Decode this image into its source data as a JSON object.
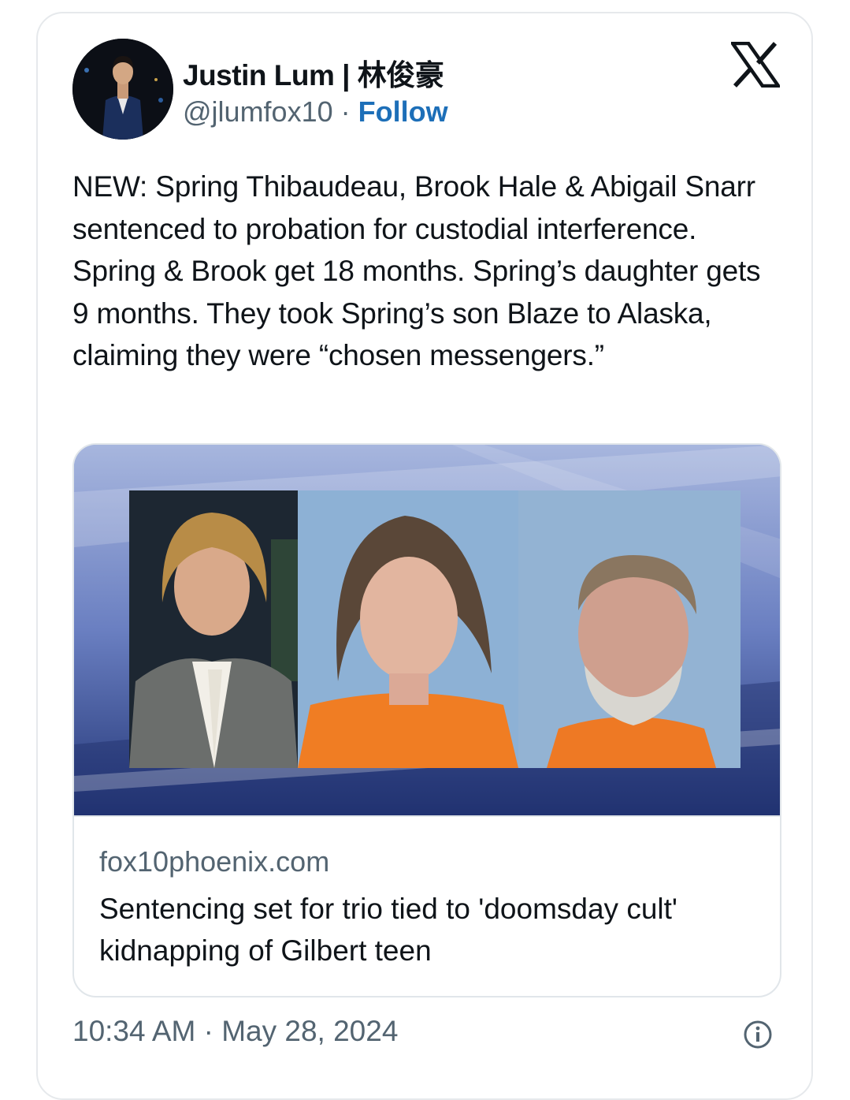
{
  "author": {
    "display_name": "Justin Lum | 林俊豪",
    "handle": "@jlumfox10",
    "separator": " · ",
    "follow_label": "Follow"
  },
  "icons": {
    "platform": "x-logo-icon",
    "info": "info-icon"
  },
  "tweet": {
    "text": "NEW: Spring Thibaudeau, Brook Hale & Abigail Snarr sentenced to probation for custodial interference. Spring & Brook get 18 months. Spring’s daughter gets 9 months. They took Spring’s son Blaze to Alaska, claiming they were “chosen messengers.”",
    "timestamp": "10:34 AM · May 28, 2024"
  },
  "link_card": {
    "domain": "fox10phoenix.com",
    "title": "Sentencing set for trio tied to 'doomsday cult' kidnapping of Gilbert teen"
  },
  "colors": {
    "follow": "#1d6fb8",
    "text_primary": "#0f1419",
    "text_secondary": "#536471",
    "border": "#e6e9ec"
  }
}
